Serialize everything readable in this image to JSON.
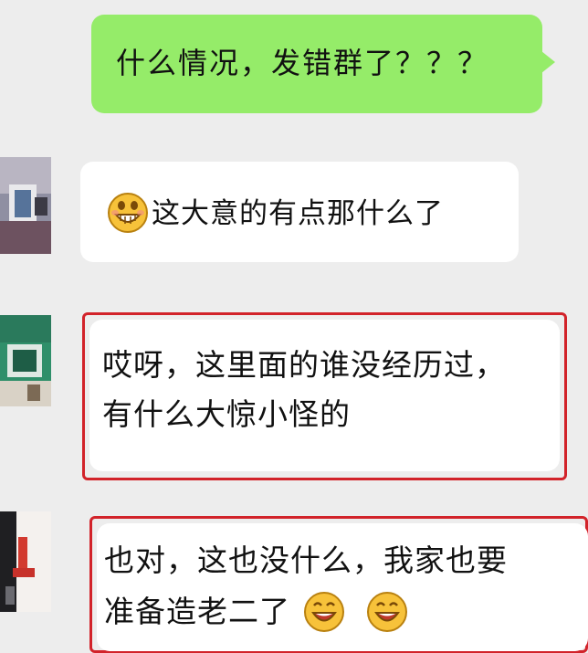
{
  "messages": [
    {
      "side": "out",
      "text": "什么情况，发错群了？？？"
    },
    {
      "side": "in",
      "avatar": "avatar-1",
      "emoji": "grin-emoji",
      "text": "这大意的有点那什么了"
    },
    {
      "side": "in",
      "avatar": "avatar-2",
      "lines": [
        "哎呀，这里面的谁没经历过，",
        "有什么大惊小怪的"
      ]
    },
    {
      "side": "in",
      "avatar": "avatar-3",
      "lines": [
        "也对，这也没什么，我家也要",
        "准备造老二了"
      ],
      "emojis": [
        "smile-emoji",
        "smile-emoji"
      ]
    }
  ],
  "colors": {
    "outgoing_bubble": "#95ec69",
    "incoming_bubble": "#ffffff",
    "highlight_border": "#d2232a",
    "background": "#ededed"
  }
}
